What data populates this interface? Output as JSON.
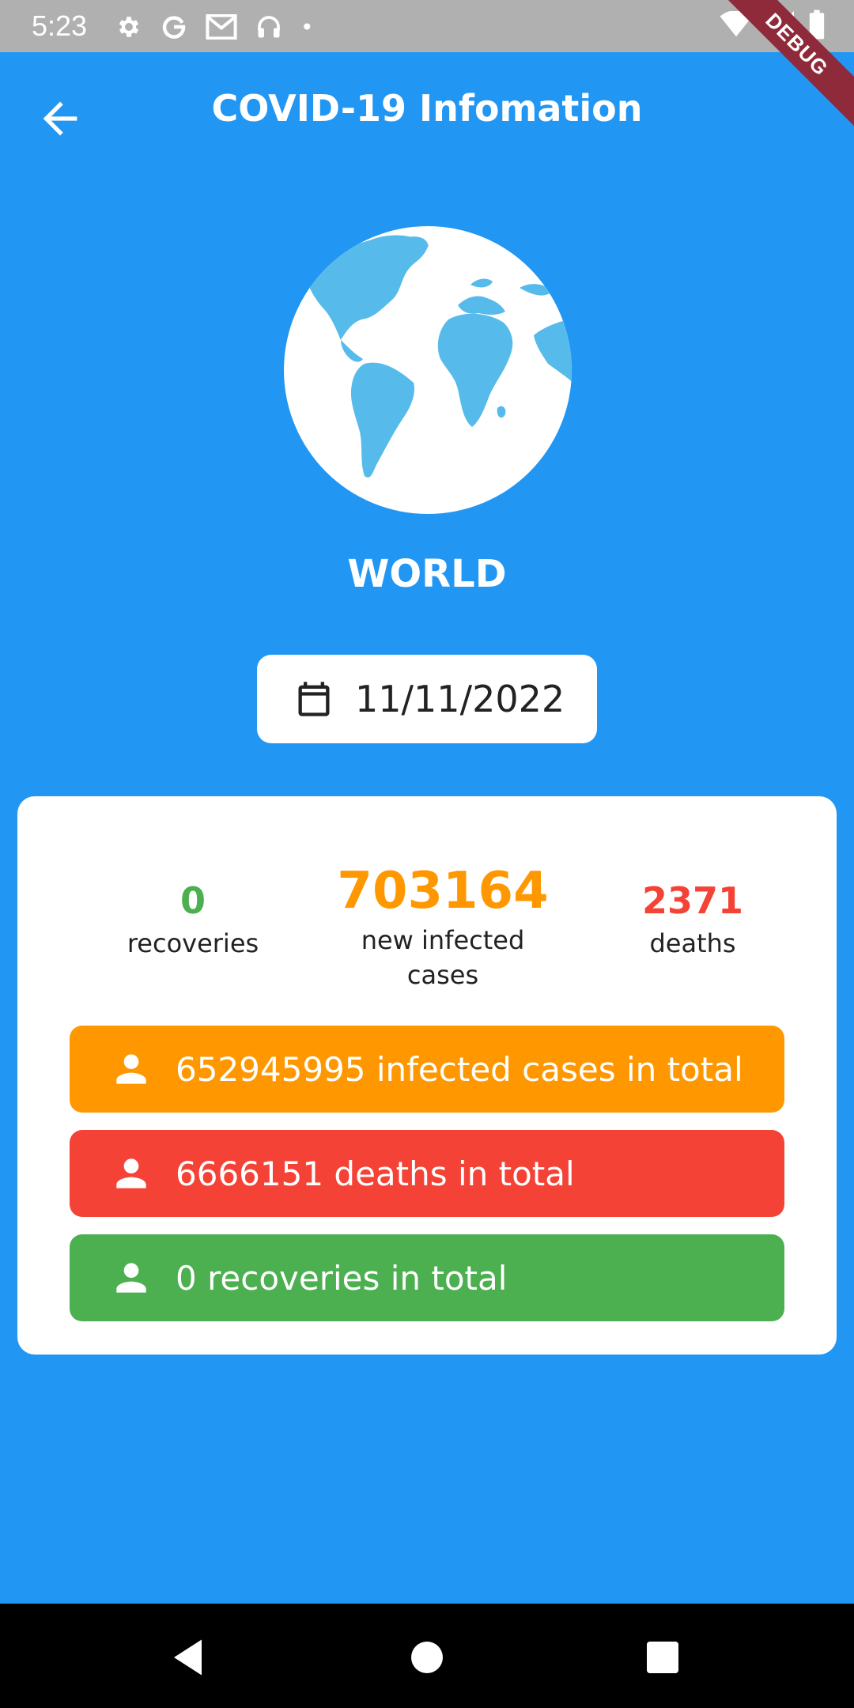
{
  "status_bar": {
    "time": "5:23",
    "icons": [
      "gear-icon",
      "google-g-icon",
      "gmail-icon",
      "headset-icon",
      "dot-icon",
      "wifi-icon",
      "signal-icon",
      "battery-icon"
    ],
    "dot": "•"
  },
  "debug_banner": "DEBUG",
  "app_bar": {
    "title": "COVID-19 Infomation",
    "back_icon": "arrow-back-icon"
  },
  "region": {
    "name": "WORLD",
    "image": "globe-icon"
  },
  "date_picker": {
    "value": "11/11/2022",
    "icon": "calendar-icon"
  },
  "daily": {
    "recoveries": {
      "value": "0",
      "label": "recoveries",
      "color": "#4CAF50"
    },
    "new_infected": {
      "value": "703164",
      "label_line1": "new infected",
      "label_line2": "cases",
      "color": "#FF9800"
    },
    "deaths": {
      "value": "2371",
      "label": "deaths",
      "color": "#F44336"
    }
  },
  "totals": {
    "infected": {
      "text": "652945995 infected cases in total",
      "color": "#FF9800",
      "icon": "person-icon"
    },
    "deaths": {
      "text": "6666151 deaths in total",
      "color": "#F44336",
      "icon": "person-icon"
    },
    "recoveries": {
      "text": "0 recoveries in total",
      "color": "#4CAF50",
      "icon": "person-icon"
    }
  },
  "colors": {
    "primary": "#2196F3",
    "status_bar": "#B0B0B0"
  },
  "nav_bar": {
    "buttons": [
      "back-triangle-icon",
      "home-circle-icon",
      "recents-square-icon"
    ]
  }
}
